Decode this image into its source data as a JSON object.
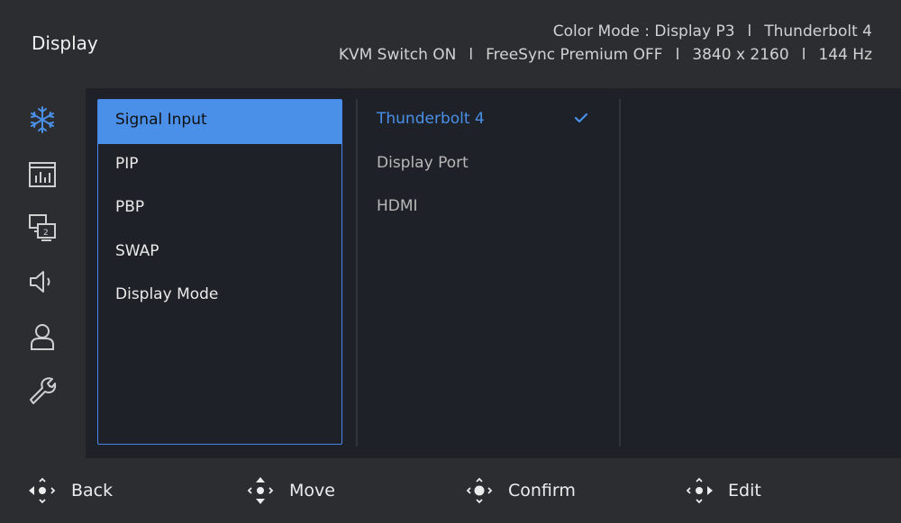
{
  "header": {
    "title": "Display",
    "line1": [
      "Color Mode : Display P3",
      "Thunderbolt 4"
    ],
    "line2": [
      "KVM Switch ON",
      "FreeSync Premium OFF",
      "3840 x 2160",
      "144 Hz"
    ],
    "separator": "l"
  },
  "sidebar": {
    "items": [
      {
        "icon": "brightness-snowflake-icon"
      },
      {
        "icon": "picture-chart-icon"
      },
      {
        "icon": "display-pip-icon"
      },
      {
        "icon": "speaker-icon"
      },
      {
        "icon": "user-icon"
      },
      {
        "icon": "wrench-icon"
      }
    ]
  },
  "menu": {
    "items": [
      "Signal Input",
      "PIP",
      "PBP",
      "SWAP",
      "Display Mode"
    ],
    "selected": "Signal Input"
  },
  "options": {
    "items": [
      "Thunderbolt 4",
      "Display Port",
      "HDMI"
    ],
    "active": "Thunderbolt 4"
  },
  "footer": {
    "back": "Back",
    "move": "Move",
    "confirm": "Confirm",
    "edit": "Edit"
  },
  "colors": {
    "accent": "#4a8fe8",
    "background": "#1e2127",
    "chrome": "#2b2d31"
  }
}
